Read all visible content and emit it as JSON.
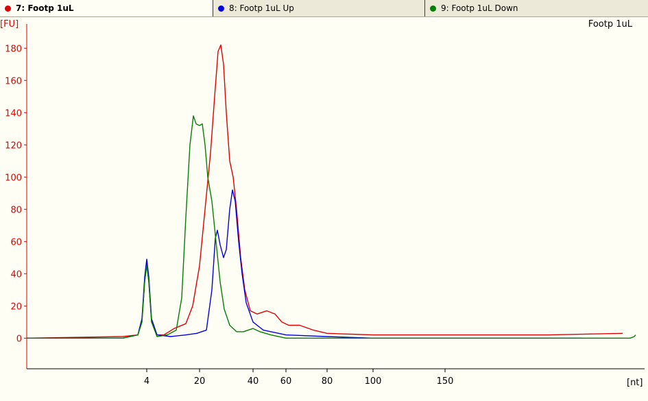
{
  "tabs": [
    {
      "label": "7: Footp 1uL",
      "color": "#e00000",
      "active": true
    },
    {
      "label": "8: Footp 1uL Up",
      "color": "#0000e0",
      "active": false
    },
    {
      "label": "9: Footp 1uL Down",
      "color": "#008000",
      "active": false
    }
  ],
  "chart_data": {
    "type": "line",
    "title": "Footp 1uL",
    "ylabel": "[FU]",
    "xlabel": "[nt]",
    "ylim": [
      -19,
      195
    ],
    "yticks": [
      0,
      20,
      40,
      60,
      80,
      100,
      120,
      140,
      160,
      180
    ],
    "xticks": [
      {
        "label": "4",
        "pos": 175
      },
      {
        "label": "20",
        "pos": 252
      },
      {
        "label": "40",
        "pos": 330
      },
      {
        "label": "60",
        "pos": 378
      },
      {
        "label": "80",
        "pos": 438
      },
      {
        "label": "100",
        "pos": 505
      },
      {
        "label": "150",
        "pos": 610
      }
    ],
    "xlim": [
      0,
      901
    ],
    "axis_color": "#e00000",
    "series": [
      {
        "name": "7: Footp 1uL",
        "color": "#e00000",
        "points": [
          [
            0,
            0
          ],
          [
            140,
            1
          ],
          [
            162,
            2
          ],
          [
            168,
            10
          ],
          [
            172,
            35
          ],
          [
            175,
            47
          ],
          [
            178,
            35
          ],
          [
            182,
            10
          ],
          [
            190,
            2
          ],
          [
            200,
            2
          ],
          [
            215,
            6
          ],
          [
            232,
            9
          ],
          [
            242,
            20
          ],
          [
            252,
            45
          ],
          [
            260,
            80
          ],
          [
            268,
            115
          ],
          [
            274,
            150
          ],
          [
            279,
            178
          ],
          [
            283,
            182
          ],
          [
            287,
            170
          ],
          [
            291,
            140
          ],
          [
            296,
            110
          ],
          [
            301,
            100
          ],
          [
            306,
            80
          ],
          [
            312,
            50
          ],
          [
            318,
            30
          ],
          [
            326,
            17
          ],
          [
            336,
            15
          ],
          [
            350,
            17
          ],
          [
            362,
            15
          ],
          [
            372,
            10
          ],
          [
            382,
            8
          ],
          [
            398,
            8
          ],
          [
            418,
            5
          ],
          [
            438,
            3
          ],
          [
            505,
            2
          ],
          [
            610,
            2
          ],
          [
            760,
            2
          ],
          [
            869,
            3
          ]
        ]
      },
      {
        "name": "8: Footp 1uL Up",
        "color": "#0000e0",
        "points": [
          [
            0,
            0
          ],
          [
            140,
            0
          ],
          [
            162,
            2
          ],
          [
            168,
            12
          ],
          [
            172,
            38
          ],
          [
            175,
            49
          ],
          [
            178,
            38
          ],
          [
            182,
            12
          ],
          [
            190,
            2
          ],
          [
            210,
            1
          ],
          [
            232,
            2
          ],
          [
            248,
            3
          ],
          [
            262,
            5
          ],
          [
            270,
            30
          ],
          [
            275,
            62
          ],
          [
            278,
            67
          ],
          [
            282,
            58
          ],
          [
            287,
            50
          ],
          [
            291,
            55
          ],
          [
            296,
            80
          ],
          [
            300,
            92
          ],
          [
            304,
            85
          ],
          [
            309,
            60
          ],
          [
            314,
            40
          ],
          [
            320,
            22
          ],
          [
            330,
            10
          ],
          [
            345,
            5
          ],
          [
            378,
            2
          ],
          [
            438,
            1
          ],
          [
            505,
            0
          ],
          [
            610,
            0
          ],
          [
            810,
            0
          ]
        ]
      },
      {
        "name": "9: Footp 1uL Down",
        "color": "#008000",
        "points": [
          [
            0,
            0
          ],
          [
            140,
            0
          ],
          [
            162,
            2
          ],
          [
            168,
            10
          ],
          [
            172,
            35
          ],
          [
            175,
            45
          ],
          [
            178,
            35
          ],
          [
            182,
            10
          ],
          [
            190,
            1
          ],
          [
            205,
            2
          ],
          [
            218,
            5
          ],
          [
            226,
            25
          ],
          [
            232,
            75
          ],
          [
            238,
            120
          ],
          [
            243,
            138
          ],
          [
            247,
            133
          ],
          [
            252,
            132
          ],
          [
            256,
            133
          ],
          [
            260,
            120
          ],
          [
            264,
            100
          ],
          [
            270,
            85
          ],
          [
            276,
            60
          ],
          [
            282,
            35
          ],
          [
            288,
            18
          ],
          [
            296,
            8
          ],
          [
            306,
            4
          ],
          [
            316,
            4
          ],
          [
            330,
            6
          ],
          [
            340,
            4
          ],
          [
            356,
            2
          ],
          [
            378,
            0
          ],
          [
            438,
            0
          ],
          [
            505,
            0
          ],
          [
            610,
            0
          ],
          [
            880,
            0
          ],
          [
            886,
            1
          ],
          [
            888,
            2
          ]
        ]
      }
    ]
  }
}
